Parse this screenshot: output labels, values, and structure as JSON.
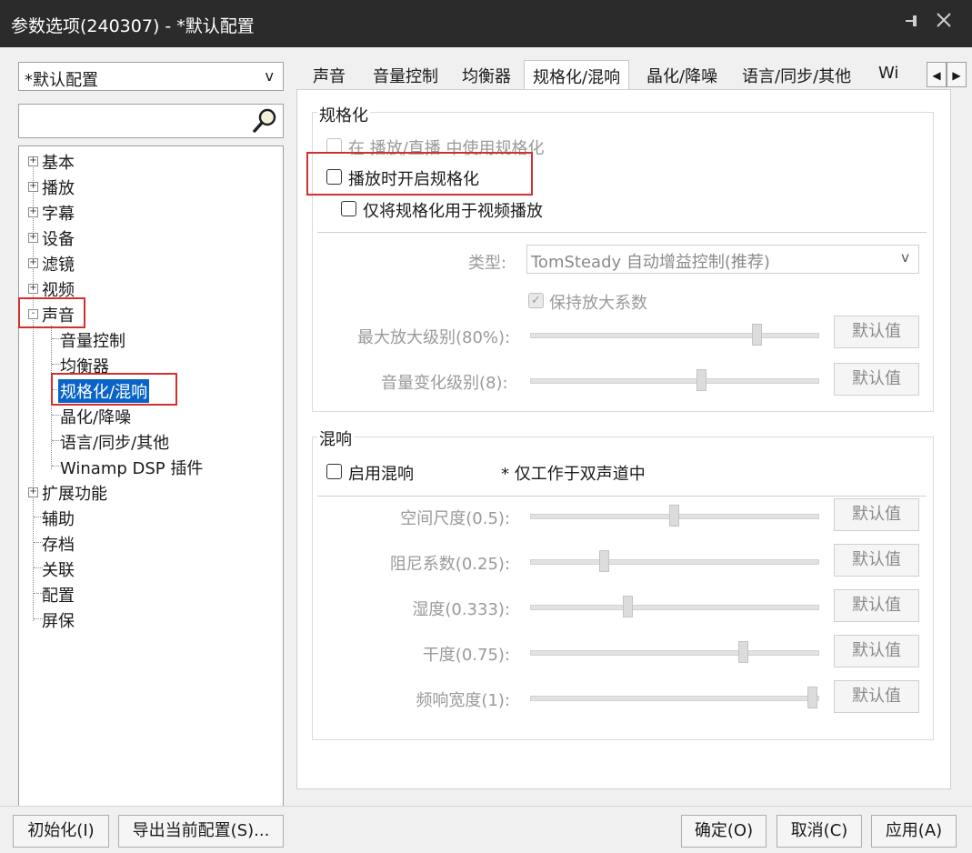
{
  "window": {
    "title": "参数选项(240307) - *默认配置",
    "pin_icon": "pin-icon",
    "close_icon": "close-icon"
  },
  "sidebar": {
    "profile_value": "*默认配置",
    "profile_arrow": "v",
    "search_placeholder": "",
    "tree": [
      {
        "label": "基本",
        "expander": "+"
      },
      {
        "label": "播放",
        "expander": "+"
      },
      {
        "label": "字幕",
        "expander": "+"
      },
      {
        "label": "设备",
        "expander": "+"
      },
      {
        "label": "滤镜",
        "expander": "+"
      },
      {
        "label": "视频",
        "expander": "+"
      },
      {
        "label": "声音",
        "expander": "-"
      },
      {
        "label": "音量控制"
      },
      {
        "label": "均衡器"
      },
      {
        "label": "规格化/混响",
        "selected": true
      },
      {
        "label": "晶化/降噪"
      },
      {
        "label": "语言/同步/其他"
      },
      {
        "label": "Winamp DSP 插件"
      },
      {
        "label": "扩展功能",
        "expander": "+"
      },
      {
        "label": "辅助"
      },
      {
        "label": "存档"
      },
      {
        "label": "关联"
      },
      {
        "label": "配置"
      },
      {
        "label": "屏保"
      }
    ]
  },
  "tabs": {
    "items": [
      "声音",
      "音量控制",
      "均衡器",
      "规格化/混响",
      "晶化/降噪",
      "语言/同步/其他",
      "Wi"
    ],
    "active": "规格化/混响",
    "scroll_left": "◀",
    "scroll_right": "▶"
  },
  "normalize": {
    "group_label": "规格化",
    "use_in_playback": "在 播放/直播 中使用规格化",
    "enable_on_play": "播放时开启规格化",
    "video_only": "仅将规格化用于视频播放",
    "type_label": "类型:",
    "type_value": "TomSteady 自动增益控制(推荐)",
    "type_arrow": "v",
    "keep_gain": "保持放大系数",
    "max_gain_label": "最大放大级别(80%):",
    "max_gain_level": 0.8,
    "volume_change_label": "音量变化级别(8):",
    "volume_change_level": 0.6,
    "default_label": "默认值"
  },
  "reverb": {
    "group_label": "混响",
    "enable": "启用混响",
    "note": "* 仅工作于双声道中",
    "sliders": [
      {
        "label": "空间尺度(0.5):",
        "level": 0.5
      },
      {
        "label": "阻尼系数(0.25):",
        "level": 0.25
      },
      {
        "label": "湿度(0.333):",
        "level": 0.333
      },
      {
        "label": "干度(0.75):",
        "level": 0.75
      },
      {
        "label": "频响宽度(1):",
        "level": 1.0
      }
    ],
    "default_label": "默认值"
  },
  "footer": {
    "init": "初始化(I)",
    "export": "导出当前配置(S)...",
    "ok": "确定(O)",
    "cancel": "取消(C)",
    "apply": "应用(A)"
  },
  "colors": {
    "selection": "#0a64c8",
    "highlight_box": "#d32f2f",
    "titlebar": "#2b2b2b"
  }
}
